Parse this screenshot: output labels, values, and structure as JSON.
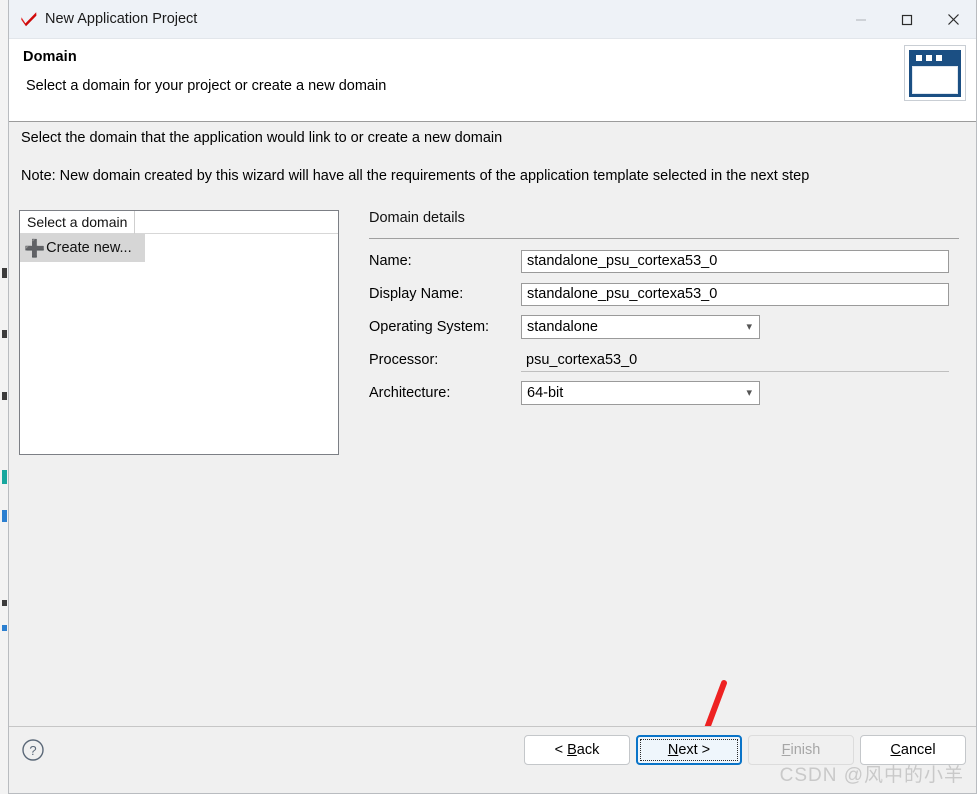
{
  "window": {
    "title": "New Application Project",
    "app_icon": "vitis-checkmark-icon",
    "controls": {
      "minimize": "—",
      "maximize": "□",
      "close": "✕"
    }
  },
  "header": {
    "title": "Domain",
    "description": "Select a domain for your project or create a new domain",
    "banner_icon": "wizard-window-icon"
  },
  "content": {
    "instruction_primary": "Select the domain that the application would link to or create a new domain",
    "instruction_note": "Note: New domain created by this wizard will have all the requirements of the application template selected in the next step"
  },
  "domain_list": {
    "column_header": "Select a domain",
    "rows": [
      {
        "label": "Create new...",
        "icon": "plus-icon",
        "selected": true
      }
    ]
  },
  "details": {
    "section_title": "Domain details",
    "fields": [
      {
        "label": "Name:",
        "value": "standalone_psu_cortexa53_0",
        "type": "text"
      },
      {
        "label": "Display Name:",
        "value": "standalone_psu_cortexa53_0",
        "type": "text"
      },
      {
        "label": "Operating System:",
        "value": "standalone",
        "type": "combo"
      },
      {
        "label": "Processor:",
        "value": "psu_cortexa53_0",
        "type": "readonly"
      },
      {
        "label": "Architecture:",
        "value": "64-bit",
        "type": "combo"
      }
    ]
  },
  "footer": {
    "help_icon": "question-mark-icon",
    "buttons": [
      {
        "id": "back",
        "prefix": "< ",
        "mnemonic": "B",
        "suffix": "ack",
        "state": "normal"
      },
      {
        "id": "next",
        "prefix": "",
        "mnemonic": "N",
        "suffix": "ext >",
        "state": "focused"
      },
      {
        "id": "finish",
        "prefix": "",
        "mnemonic": "F",
        "suffix": "inish",
        "state": "disabled"
      },
      {
        "id": "cancel",
        "prefix": "",
        "mnemonic": "C",
        "suffix": "ancel",
        "state": "normal"
      }
    ],
    "watermark": "CSDN @风中的小羊"
  },
  "annotation": {
    "arrow_color": "#ee2222",
    "points_to": "next-button"
  },
  "colors": {
    "titlebar": "#eef2f7",
    "body": "#f0f0f0",
    "header_band": "#ffffff",
    "accent_blue": "#1b4f83",
    "focus_blue": "#0a74c8",
    "selection_gray": "#d6d6d6"
  }
}
